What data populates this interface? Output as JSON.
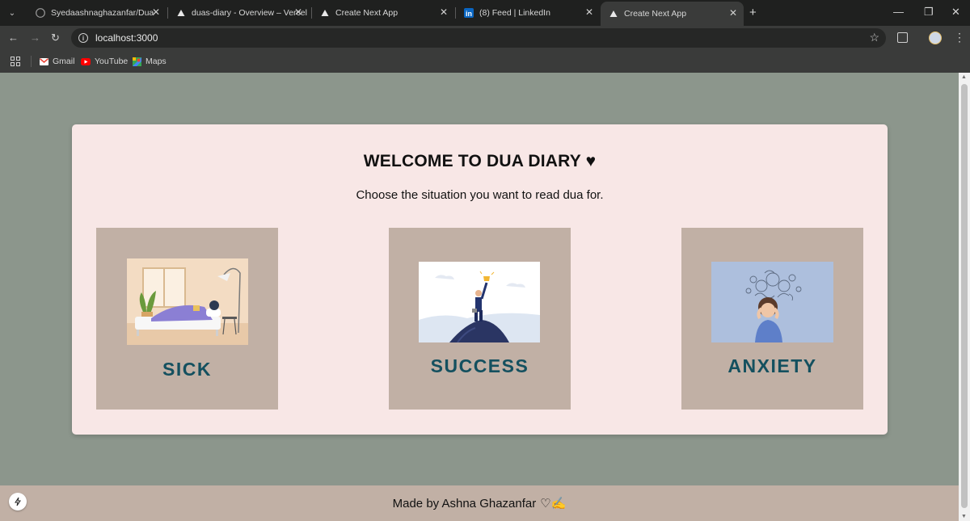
{
  "browser": {
    "tabs": [
      {
        "title": "Syedaashnaghazanfar/Duas-dia",
        "icon": "github-icon"
      },
      {
        "title": "duas-diary - Overview – Vercel",
        "icon": "vercel-icon"
      },
      {
        "title": "Create Next App",
        "icon": "vercel-icon"
      },
      {
        "title": "(8) Feed | LinkedIn",
        "icon": "linkedin-icon"
      },
      {
        "title": "Create Next App",
        "icon": "vercel-icon",
        "active": true
      }
    ],
    "url": "localhost:3000",
    "bookmarks": [
      {
        "label": "Gmail",
        "icon": "gmail-icon"
      },
      {
        "label": "YouTube",
        "icon": "youtube-icon"
      },
      {
        "label": "Maps",
        "icon": "maps-icon"
      }
    ]
  },
  "page": {
    "heading": "WELCOME TO DUA DIARY",
    "heading_icon": "♥",
    "subheading": "Choose the situation you want to read dua for.",
    "categories": [
      {
        "label": "SICK",
        "image": "sick-illustration"
      },
      {
        "label": "SUCCESS",
        "image": "success-illustration"
      },
      {
        "label": "ANXIETY",
        "image": "anxiety-illustration"
      }
    ],
    "footer": {
      "text": "Made by Ashna Ghazanfar",
      "glyphs": "♡✍"
    }
  },
  "colors": {
    "background": "#8c968c",
    "card": "#f8e7e6",
    "tile": "#c1b0a5",
    "label": "#14505f",
    "footer": "#c1b0a5"
  }
}
